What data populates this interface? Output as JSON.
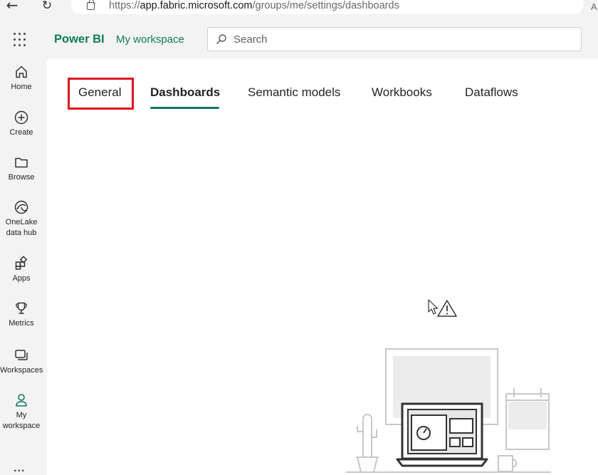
{
  "browser": {
    "back_icon": "back-arrow-icon",
    "reload_icon": "reload-icon",
    "url_prefix": "https://",
    "url_host": "app.fabric.microsoft.com",
    "url_path": "/groups/me/settings/dashboards",
    "profile_letter": "A"
  },
  "header": {
    "app_name": "Power BI",
    "workspace": "My workspace",
    "search_placeholder": "Search"
  },
  "nav": {
    "items": [
      {
        "label": "Home",
        "icon": "home-icon"
      },
      {
        "label": "Create",
        "icon": "plus-circle-icon"
      },
      {
        "label": "Browse",
        "icon": "folder-icon"
      },
      {
        "label": "OneLake",
        "label2": "data hub",
        "icon": "onelake-icon"
      },
      {
        "label": "Apps",
        "icon": "apps-icon"
      },
      {
        "label": "Metrics",
        "icon": "trophy-icon"
      },
      {
        "label": "Workspaces",
        "icon": "workspaces-icon"
      },
      {
        "label": "My",
        "label2": "workspace",
        "icon": "person-icon"
      }
    ],
    "more": "..."
  },
  "tabs": [
    {
      "label": "General",
      "active": false
    },
    {
      "label": "Dashboards",
      "active": true
    },
    {
      "label": "Semantic models",
      "active": false
    },
    {
      "label": "Workbooks",
      "active": false
    },
    {
      "label": "Dataflows",
      "active": false
    }
  ],
  "colors": {
    "brand": "#107c5a",
    "accent": "#117865",
    "highlight": "#e0141e"
  }
}
